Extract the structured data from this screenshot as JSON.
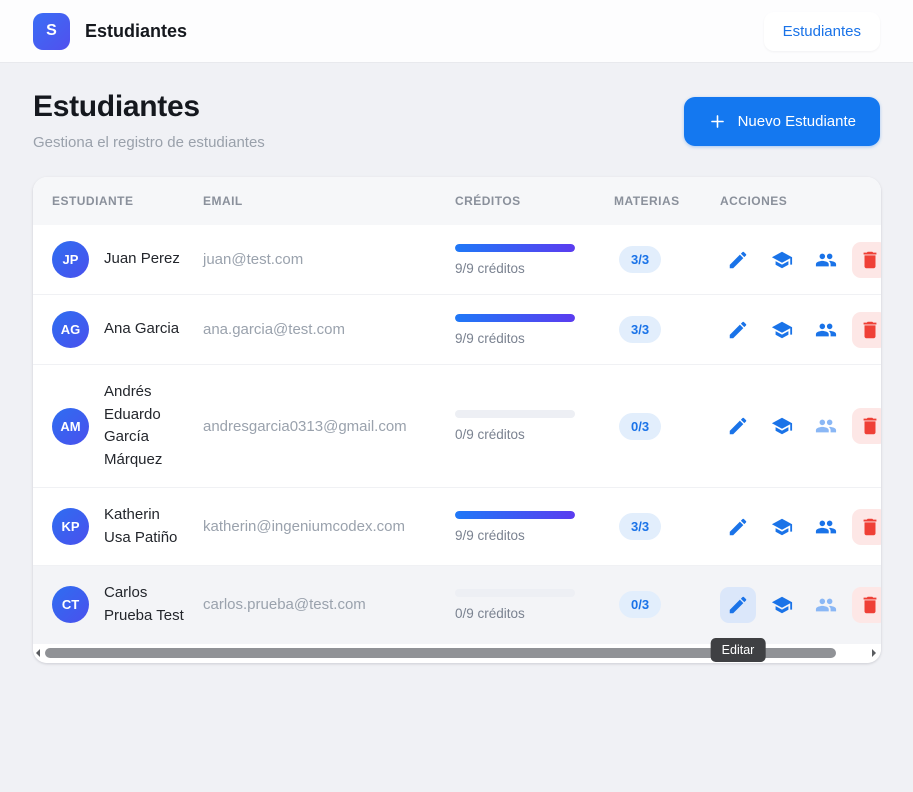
{
  "app": {
    "logo_letter": "S",
    "brand_title": "Estudiantes",
    "nav_button_label": "Estudiantes"
  },
  "page": {
    "title": "Estudiantes",
    "subtitle": "Gestiona el registro de estudiantes",
    "new_student_button_label": "Nuevo Estudiante"
  },
  "table": {
    "columns": [
      "ESTUDIANTE",
      "EMAIL",
      "CRÉDITOS",
      "MATERIAS",
      "ACCIONES"
    ],
    "rows": [
      {
        "initials": "JP",
        "name": "Juan Perez",
        "email": "juan@test.com",
        "credits_label": "9/9 créditos",
        "credits_pct": 100,
        "materias": "3/3",
        "people_disabled": false,
        "hover": false,
        "edit_active": false
      },
      {
        "initials": "AG",
        "name": "Ana Garcia",
        "email": "ana.garcia@test.com",
        "credits_label": "9/9 créditos",
        "credits_pct": 100,
        "materias": "3/3",
        "people_disabled": false,
        "hover": false,
        "edit_active": false
      },
      {
        "initials": "AM",
        "name": "Andrés Eduardo García Márquez",
        "email": "andresgarcia0313@gmail.com",
        "credits_label": "0/9 créditos",
        "credits_pct": 0,
        "materias": "0/3",
        "people_disabled": true,
        "hover": false,
        "edit_active": false
      },
      {
        "initials": "KP",
        "name": "Katherin Usa Patiño",
        "email": "katherin@ingeniumcodex.com",
        "credits_label": "9/9 créditos",
        "credits_pct": 100,
        "materias": "3/3",
        "people_disabled": false,
        "hover": false,
        "edit_active": false
      },
      {
        "initials": "CT",
        "name": "Carlos Prueba Test",
        "email": "carlos.prueba@test.com",
        "credits_label": "0/9 créditos",
        "credits_pct": 0,
        "materias": "0/3",
        "people_disabled": true,
        "hover": true,
        "edit_active": true
      }
    ]
  },
  "tooltip": {
    "edit": "Editar"
  },
  "colors": {
    "accent_blue": "#1a73e8",
    "button_blue": "#1478f0",
    "progress_gradient_start": "#1f78f7",
    "progress_gradient_end": "#5b3cf0",
    "danger_red": "#ef4036",
    "badge_bg": "#e2eefc",
    "page_bg": "#f0f1f5"
  }
}
